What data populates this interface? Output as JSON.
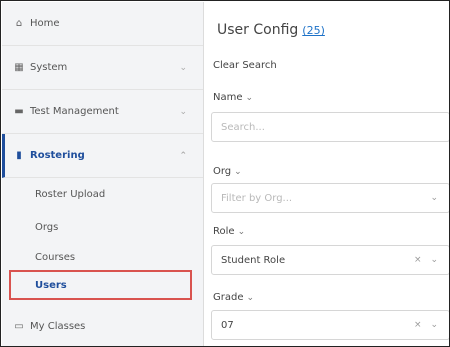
{
  "sidebar": {
    "items": [
      {
        "label": "Home",
        "icon": "home-icon"
      },
      {
        "label": "System",
        "icon": "grid-icon"
      },
      {
        "label": "Test Management",
        "icon": "folder-icon"
      },
      {
        "label": "Rostering",
        "icon": "roster-icon"
      }
    ],
    "sub_items": [
      {
        "label": "Roster Upload"
      },
      {
        "label": "Orgs"
      },
      {
        "label": "Courses"
      },
      {
        "label": "Users"
      }
    ],
    "my_classes": {
      "label": "My Classes",
      "icon": "classes-icon"
    }
  },
  "main": {
    "title": "User Config",
    "count": "(25)",
    "clear_search": "Clear Search",
    "filters": {
      "name": {
        "label": "Name",
        "placeholder": "Search..."
      },
      "org": {
        "label": "Org",
        "placeholder": "Filter by Org..."
      },
      "role": {
        "label": "Role",
        "value": "Student Role"
      },
      "grade": {
        "label": "Grade",
        "value": "07"
      }
    }
  },
  "colors": {
    "accent": "#1f4e9c",
    "link": "#1e72c8",
    "highlight": "#d9534f"
  }
}
